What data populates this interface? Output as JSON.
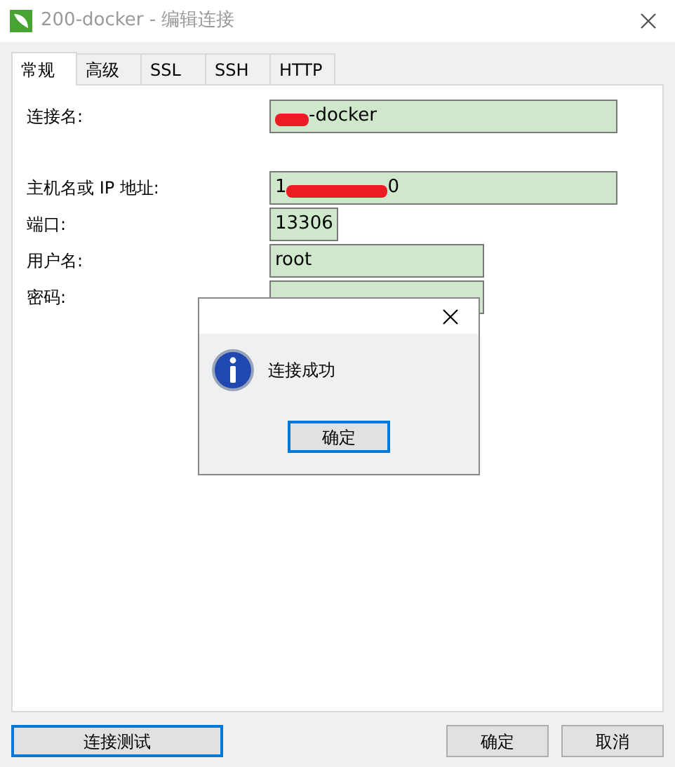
{
  "window": {
    "title": "200-docker - 编辑连接"
  },
  "tabs": [
    {
      "label": "常规",
      "selected": true
    },
    {
      "label": "高级",
      "selected": false
    },
    {
      "label": "SSL",
      "selected": false
    },
    {
      "label": "SSH",
      "selected": false
    },
    {
      "label": "HTTP",
      "selected": false
    }
  ],
  "fields": [
    {
      "label": "连接名:",
      "after": "-docker",
      "redacted": true
    },
    {
      "label": "主机名或 IP 地址:",
      "before": "1",
      "after": "0",
      "redacted": true
    },
    {
      "label": "端口:",
      "after": "13306"
    },
    {
      "label": "用户名:",
      "after": "root"
    },
    {
      "label": "密码:"
    }
  ],
  "buttons": [
    {
      "label": "连接测试",
      "focused": true
    },
    {
      "label": "确定",
      "focused": false
    },
    {
      "label": "取消",
      "focused": false
    }
  ],
  "dialog": {
    "message": "连接成功",
    "button": "确定"
  }
}
